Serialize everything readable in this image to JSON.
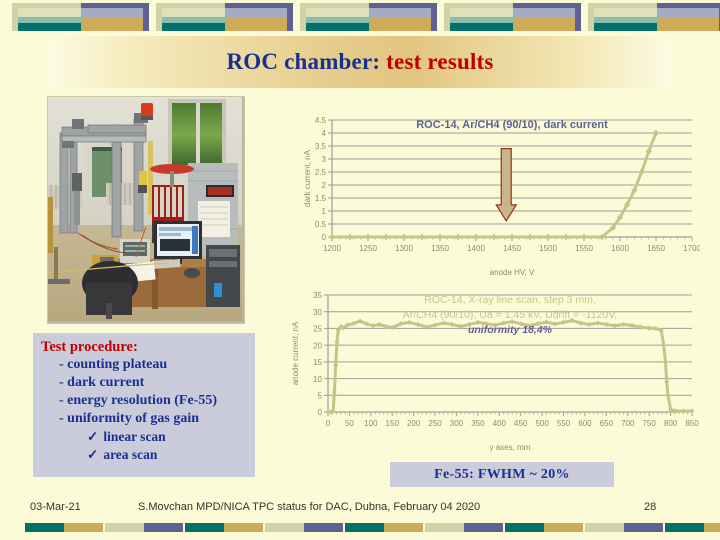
{
  "slide": {
    "title_part1": "ROC chamber:",
    "title_part2": " test results",
    "background_color": "#fbfbd8"
  },
  "decor": {
    "top_block_count": 5,
    "bottom_block_count": 9,
    "colors": {
      "sage": "#cfd4a6",
      "light_sage": "#dde2bb",
      "teal_light": "#8dbcae",
      "teal": "#00706b",
      "purple": "#5f6192",
      "lavender": "#a7a8c4",
      "gold": "#cdab58"
    }
  },
  "photo": {
    "alt": "Laboratory test stand with gantry scanner frame, desk with two monitors, chair and electronics racks"
  },
  "procedure": {
    "heading": "Test procedure:",
    "items": [
      "- counting plateau",
      "- dark current",
      "- energy resolution (Fe-55)",
      "- uniformity of gas gain"
    ],
    "subitems": [
      "linear scan",
      "area scan"
    ],
    "check_glyph": "✓",
    "heading_color": "#c00000",
    "item_color": "#1a2f8f",
    "background_color": "#cbccdb"
  },
  "fe55": {
    "text": "Fe-55:  FWHM ~ 20%",
    "background_color": "#cbccdb",
    "text_color": "#1a2f8f"
  },
  "footer": {
    "date": "03-Mar-21",
    "center": "S.Movchan  MPD/NICA TPC status for DAC, Dubna, February 04  2020",
    "page": "28"
  },
  "chart_data": [
    {
      "id": "dark-current",
      "type": "line",
      "title": "ROC-14, Ar/CH4 (90/10), dark current",
      "title_color": "#5f6192",
      "series_color": "#c5c58a",
      "xlabel": "anode HV, V",
      "ylabel": "dark current, nA",
      "xlim": [
        1200,
        1700
      ],
      "ylim": [
        0,
        4.5
      ],
      "xticks": [
        1200,
        1250,
        1300,
        1350,
        1400,
        1450,
        1500,
        1550,
        1600,
        1650,
        1700
      ],
      "yticks": [
        0,
        0.5,
        1,
        1.5,
        2,
        2.5,
        3,
        3.5,
        4,
        4.5
      ],
      "grid": true,
      "legend": "none",
      "markers": true,
      "x": [
        1200,
        1225,
        1250,
        1275,
        1300,
        1325,
        1350,
        1375,
        1400,
        1425,
        1450,
        1475,
        1500,
        1525,
        1550,
        1575,
        1590,
        1600,
        1610,
        1620,
        1630,
        1640,
        1650
      ],
      "y": [
        0,
        0,
        0,
        0,
        0,
        0,
        0,
        0,
        0,
        0,
        0,
        0,
        0,
        0,
        0,
        0,
        0.35,
        0.75,
        1.25,
        1.8,
        2.5,
        3.3,
        4.0
      ],
      "annotation": {
        "type": "down-arrow",
        "x": 1442,
        "y_top": 3.4,
        "y_bottom": 0.62,
        "fill": "#c8b58a",
        "stroke": "#a03020"
      }
    },
    {
      "id": "line-scan",
      "type": "line",
      "title_lines": [
        "ROC-14, X-ray line scan, step 3 mm,",
        "Ar/CH4 (90/10), Ua = 1,45 kV, Udrift = -1120V,"
      ],
      "annotation_text": "uniformity 18,4%",
      "title_color": "#c5c58a",
      "annotation_color": "#5f6192",
      "series_color": "#c5c58a",
      "xlabel": "y axes, mm",
      "ylabel": "anode current, nA",
      "xlim": [
        0,
        850
      ],
      "ylim": [
        0,
        35
      ],
      "xticks": [
        0,
        50,
        100,
        150,
        200,
        250,
        300,
        350,
        400,
        450,
        500,
        550,
        600,
        650,
        700,
        750,
        800,
        850
      ],
      "yticks": [
        0,
        5,
        10,
        15,
        20,
        25,
        30,
        35
      ],
      "grid": true,
      "legend": "none",
      "markers": true,
      "x": [
        0,
        6,
        12,
        15,
        18,
        21,
        24,
        30,
        36,
        45,
        60,
        75,
        90,
        105,
        120,
        135,
        150,
        170,
        190,
        210,
        230,
        250,
        270,
        290,
        310,
        330,
        350,
        370,
        390,
        410,
        430,
        450,
        470,
        490,
        510,
        530,
        550,
        570,
        590,
        610,
        630,
        650,
        670,
        690,
        710,
        730,
        750,
        765,
        778,
        784,
        788,
        791,
        794,
        800,
        812,
        830,
        850
      ],
      "y": [
        0,
        0,
        0.2,
        6,
        14,
        21,
        24.5,
        25.5,
        25.2,
        26,
        26.5,
        27.2,
        26.4,
        25.8,
        26.2,
        25.6,
        25.2,
        26.4,
        26.8,
        26.2,
        25.4,
        26.0,
        26.6,
        26.2,
        25.6,
        26.2,
        26.8,
        26.4,
        26.0,
        26.6,
        27.0,
        26.4,
        25.8,
        26.4,
        26.9,
        26.3,
        26.8,
        27.4,
        26.6,
        26.2,
        26.6,
        26.2,
        25.8,
        26.2,
        25.9,
        25.4,
        25.1,
        25.0,
        24.4,
        20,
        15,
        9,
        5,
        0.8,
        0.3,
        0.3,
        0.3
      ]
    }
  ]
}
